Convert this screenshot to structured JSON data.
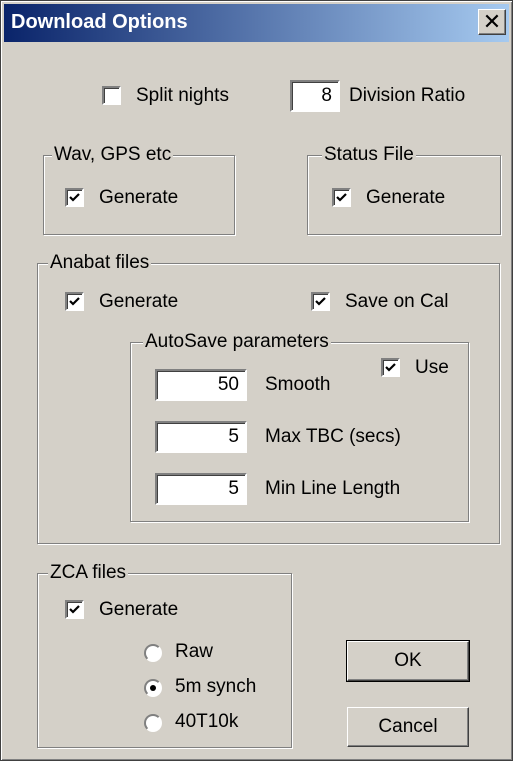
{
  "window": {
    "title": "Download Options",
    "close": "✕"
  },
  "top": {
    "split_nights": "Split nights",
    "split_nights_checked": false,
    "division_ratio_value": "8",
    "division_ratio_label": "Division Ratio"
  },
  "wav_group": {
    "title": "Wav, GPS etc",
    "generate": "Generate",
    "generate_checked": true
  },
  "status_group": {
    "title": "Status File",
    "generate": "Generate",
    "generate_checked": true
  },
  "anabat": {
    "title": "Anabat files",
    "generate": "Generate",
    "generate_checked": true,
    "save_on_cal": "Save on Cal",
    "save_on_cal_checked": true,
    "autosave": {
      "title": "AutoSave parameters",
      "use": "Use",
      "use_checked": true,
      "smooth_value": "50",
      "smooth_label": "Smooth",
      "max_tbc_value": "5",
      "max_tbc_label": "Max TBC (secs)",
      "min_line_value": "5",
      "min_line_label": "Min Line Length"
    }
  },
  "zca": {
    "title": "ZCA files",
    "generate": "Generate",
    "generate_checked": true,
    "options": [
      "Raw",
      "5m synch",
      "40T10k"
    ],
    "selected": "5m synch"
  },
  "buttons": {
    "ok": "OK",
    "cancel": "Cancel"
  }
}
